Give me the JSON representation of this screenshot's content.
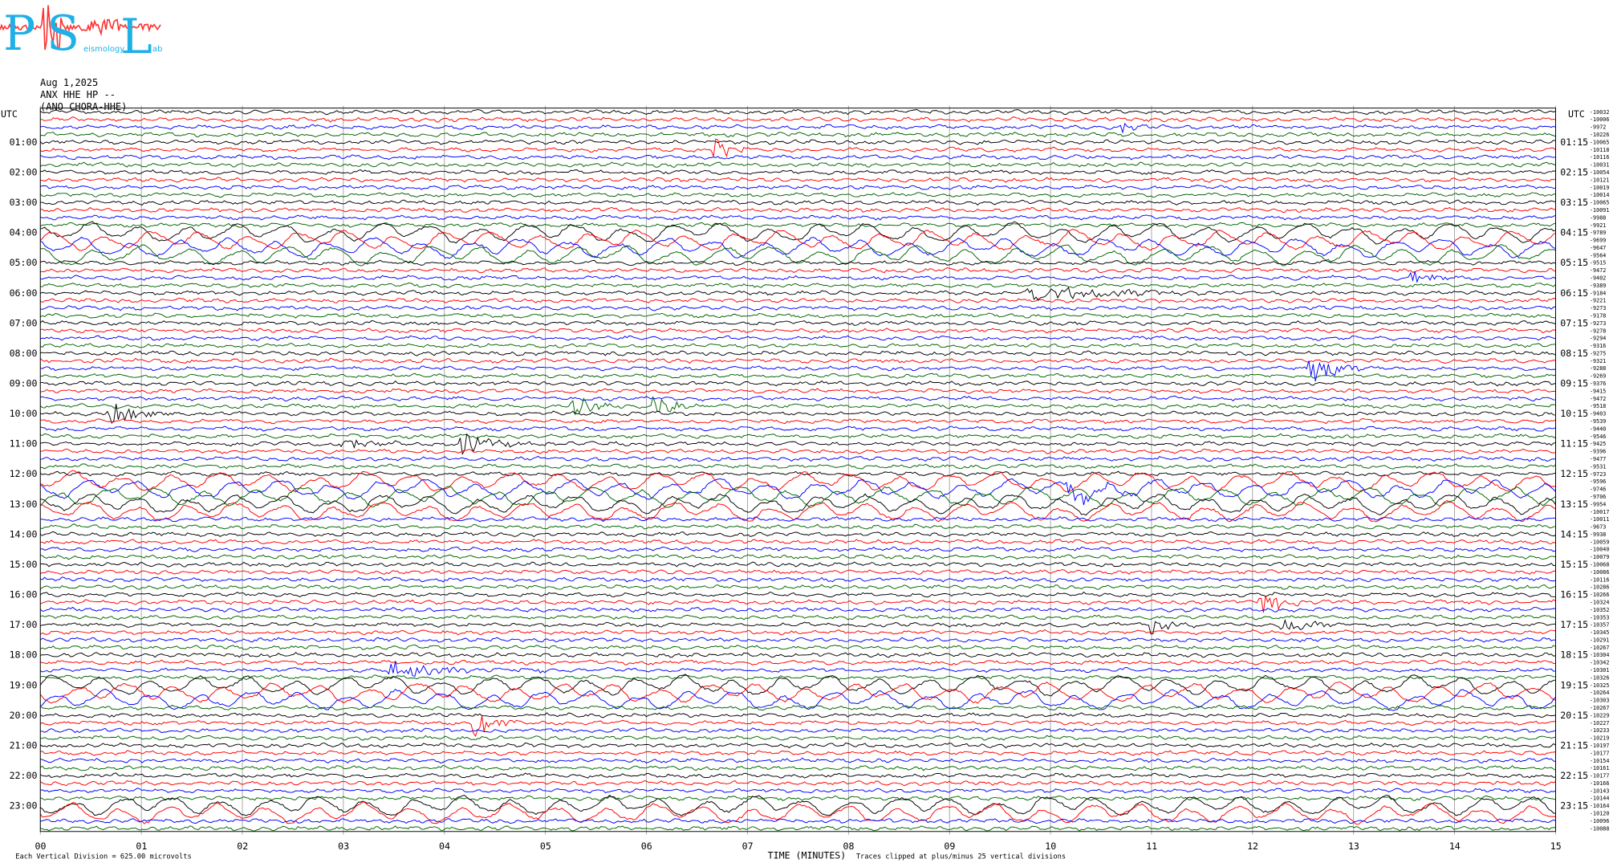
{
  "logo": {
    "letters": [
      "P",
      "S",
      "L"
    ],
    "small_text": [
      "eismology",
      "ab"
    ],
    "colors": {
      "letters": "#1fb0e6",
      "wave": "#ff3030"
    }
  },
  "header": {
    "date": "Aug 1,2025",
    "station": "ANX HHE HP --",
    "channel": "(ANO CHORA-HHE)"
  },
  "chart_data": {
    "type": "line",
    "kind": "helicorder",
    "rows": 96,
    "minutes_per_row": 15,
    "trace_colors": [
      "#000000",
      "#ff0000",
      "#0000ff",
      "#006400"
    ],
    "left_header": "UTC",
    "right_header": "UTC",
    "left_hour_labels": [
      "01:00",
      "02:00",
      "03:00",
      "04:00",
      "05:00",
      "06:00",
      "07:00",
      "08:00",
      "09:00",
      "10:00",
      "11:00",
      "12:00",
      "13:00",
      "14:00",
      "15:00",
      "16:00",
      "17:00",
      "18:00",
      "19:00",
      "20:00",
      "21:00",
      "22:00",
      "23:00"
    ],
    "right_hour_labels": [
      "01:15",
      "02:15",
      "03:15",
      "04:15",
      "05:15",
      "06:15",
      "07:15",
      "08:15",
      "09:15",
      "10:15",
      "11:15",
      "12:15",
      "13:15",
      "14:15",
      "15:15",
      "16:15",
      "17:15",
      "18:15",
      "19:15",
      "20:15",
      "21:15",
      "22:15",
      "23:15"
    ],
    "x_ticks": [
      "00",
      "01",
      "02",
      "03",
      "04",
      "05",
      "06",
      "07",
      "08",
      "09",
      "10",
      "11",
      "12",
      "13",
      "14",
      "15"
    ],
    "xlabel": "TIME (MINUTES)",
    "x_range": [
      0,
      15
    ],
    "grid": "vertical-minute-lines",
    "row_offsets": [
      "-10032",
      "-10006",
      "-9972",
      "-10226",
      "-10065",
      "-10118",
      "-10116",
      "-10031",
      "-10054",
      "-10121",
      "-10019",
      "-10014",
      "-10065",
      "-10091",
      "-9988",
      "-9921",
      "-9789",
      "-9699",
      "-9647",
      "-9564",
      "-9515",
      "-9472",
      "-9402",
      "-9389",
      "-9184",
      "-9221",
      "-9273",
      "-9178",
      "-9273",
      "-9278",
      "-9294",
      "-9316",
      "-9275",
      "-9321",
      "-9288",
      "-9269",
      "-9376",
      "-9415",
      "-9472",
      "-9518",
      "-9403",
      "-9539",
      "-9440",
      "-9546",
      "-9425",
      "-9396",
      "-9477",
      "-9531",
      "-9723",
      "-9596",
      "-9746",
      "-9706",
      "-9954",
      "-10017",
      "-10011",
      "-9673",
      "-9938",
      "-10059",
      "-10040",
      "-10079",
      "-10068",
      "-10086",
      "-10116",
      "-10286",
      "-10266",
      "-10324",
      "-10352",
      "-10353",
      "-10357",
      "-10345",
      "-10291",
      "-10267",
      "-10304",
      "-10342",
      "-10301",
      "-10326",
      "-10325",
      "-10264",
      "-10303",
      "-10267",
      "-10229",
      "-10227",
      "-10233",
      "-10219",
      "-10197",
      "-10177",
      "-10154",
      "-10161",
      "-10177",
      "-10166",
      "-10143",
      "-10144",
      "-10164",
      "-10120",
      "-10096",
      "-10088"
    ],
    "events": [
      {
        "row": 5,
        "minute": 6.7,
        "amp": 1.6,
        "dur": 0.4
      },
      {
        "row": 2,
        "minute": 10.75,
        "amp": 0.7,
        "dur": 0.2
      },
      {
        "row": 40,
        "minute": 0.7,
        "amp": 1.2,
        "dur": 0.7
      },
      {
        "row": 39,
        "minute": 5.3,
        "amp": 1.1,
        "dur": 0.5
      },
      {
        "row": 39,
        "minute": 6.1,
        "amp": 1.0,
        "dur": 0.5
      },
      {
        "row": 34,
        "minute": 12.6,
        "amp": 1.5,
        "dur": 0.5
      },
      {
        "row": 44,
        "minute": 4.2,
        "amp": 1.3,
        "dur": 0.8
      },
      {
        "row": 44,
        "minute": 3.0,
        "amp": 0.7,
        "dur": 0.6
      },
      {
        "row": 65,
        "minute": 12.1,
        "amp": 1.3,
        "dur": 0.4
      },
      {
        "row": 68,
        "minute": 11.0,
        "amp": 0.9,
        "dur": 0.6
      },
      {
        "row": 68,
        "minute": 12.3,
        "amp": 0.9,
        "dur": 0.6
      },
      {
        "row": 81,
        "minute": 4.3,
        "amp": 1.4,
        "dur": 0.4
      },
      {
        "row": 74,
        "minute": 3.5,
        "amp": 0.8,
        "dur": 1.5
      },
      {
        "row": 50,
        "minute": 10.2,
        "amp": 0.8,
        "dur": 0.8
      },
      {
        "row": 24,
        "minute": 9.8,
        "amp": 0.9,
        "dur": 1.8
      },
      {
        "row": 22,
        "minute": 13.6,
        "amp": 0.7,
        "dur": 0.4
      }
    ],
    "swell_rows": [
      16,
      17,
      18,
      19,
      49,
      50,
      51,
      52,
      53,
      76,
      77,
      78,
      92,
      93
    ]
  },
  "footer": {
    "scale_text": "Each Vertical Division =  625.00 microvolts",
    "clip_text": "Traces clipped at plus/minus 25 vertical divisions"
  }
}
